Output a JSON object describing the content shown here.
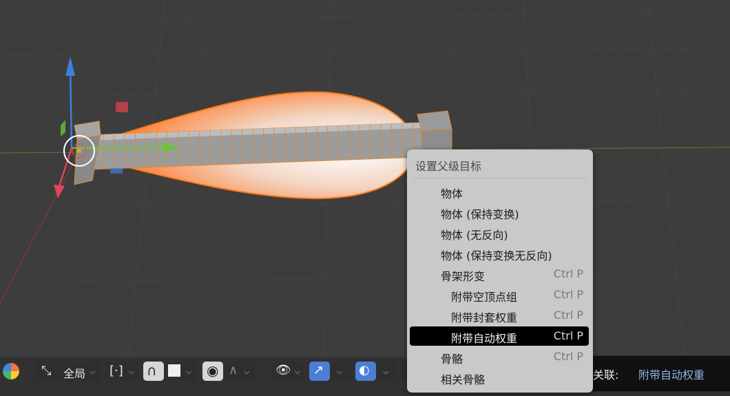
{
  "context_menu": {
    "title": "设置父级目标",
    "items": [
      {
        "label": "物体",
        "shortcut": ""
      },
      {
        "label": "物体 (保持变换)",
        "shortcut": ""
      },
      {
        "label": "物体 (无反向)",
        "shortcut": ""
      },
      {
        "label": "物体 (保持变换无反向)",
        "shortcut": ""
      },
      {
        "label": "骨架形变",
        "shortcut": "Ctrl P"
      },
      {
        "label": "附带空顶点组",
        "shortcut": "Ctrl P"
      },
      {
        "label": "附带封套权重",
        "shortcut": "Ctrl P"
      },
      {
        "label": "附带自动权重",
        "shortcut": "Ctrl P"
      },
      {
        "label": "骨骼",
        "shortcut": "Ctrl P"
      },
      {
        "label": "相关骨骼",
        "shortcut": ""
      }
    ],
    "highlighted_index": 7
  },
  "header": {
    "orientation_label": "全局"
  },
  "status_tip": {
    "label": "设置物体的父级关联:",
    "value": "附带自动权重"
  },
  "colors": {
    "viewport_bg": "#3d3d3d",
    "selection_orange": "#ff7a1a",
    "axis_x": "#e0455a",
    "axis_y": "#6ec23b",
    "axis_z": "#3f7fe0",
    "menu_bg": "#c9c9c9",
    "menu_active": "#000000"
  }
}
